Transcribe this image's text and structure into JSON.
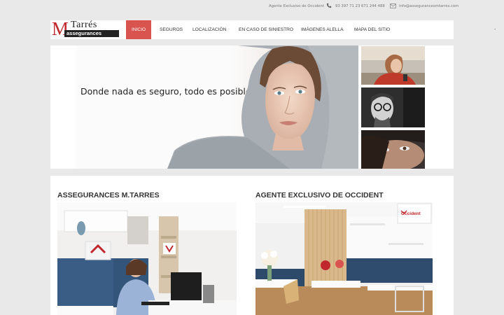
{
  "topbar": {
    "agent_text": "Agente Exclusivo de Occident",
    "phone1": "93 397 71 23",
    "phone2": "671 244 488",
    "email": "info@assegurancesmtarres.com",
    "icons": [
      "phone-icon",
      "mail-icon"
    ]
  },
  "logo": {
    "letter": "M",
    "name": "Tarrés",
    "sub": "assegurances"
  },
  "nav": {
    "items": [
      {
        "label": "INICIO",
        "active": true
      },
      {
        "label": "SEGUROS"
      },
      {
        "label": "LOCALIZACIÓN"
      },
      {
        "label": "EN CASO DE SINIESTRO"
      },
      {
        "label": "IMÁGENES ALELLA"
      },
      {
        "label": "MAPA DEL SITIO"
      }
    ],
    "extra": "-"
  },
  "hero": {
    "caption": "Donde nada es seguro, todo es posible"
  },
  "sections": {
    "left_title": "ASSEGURANCES M.TARRES",
    "right_title": "AGENTE EXCLUSIVO DE OCCIDENT",
    "occident_label": "Occident"
  },
  "colors": {
    "accent": "#d9534f",
    "brand_red": "#c0272d",
    "background": "#e9e9e9"
  }
}
